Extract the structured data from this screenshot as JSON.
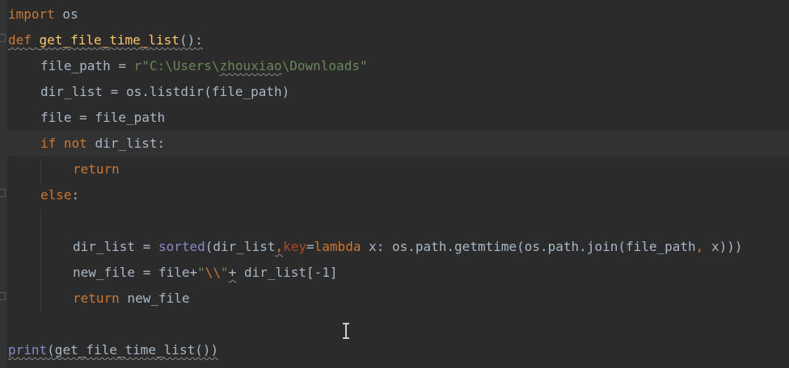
{
  "editor": {
    "lines": {
      "l1": {
        "kw_import": "import",
        "rest": " os"
      },
      "l2": {
        "kw_def": "def",
        "sp": " ",
        "fn_name": "get_file_time_list",
        "paren": "():"
      },
      "l3": {
        "lhs": "file_path = ",
        "str_prefix": "r\"C:\\Users\\",
        "str_user": "zhouxiao",
        "str_rest": "\\Downloads\""
      },
      "l4": {
        "text": "dir_list = os.listdir(file_path)"
      },
      "l5": {
        "text": "file = file_path"
      },
      "l6": {
        "kw_if": "if",
        "sp": " ",
        "kw_not": "not",
        "rest": " dir_list:"
      },
      "l7": {
        "kw_return": "return"
      },
      "l8": {
        "kw_else": "else",
        "colon": ":"
      },
      "l10": {
        "lhs": "dir_list = ",
        "builtin_sorted": "sorted",
        "part1": "(dir_list",
        "comma": ",",
        "param_key": "key",
        "eq": "=",
        "kw_lambda": "lambda",
        "part2": " x: os.path.getmtime(os.path.join(file_path",
        "comma2": ",",
        "part3": " x)))"
      },
      "l11": {
        "lhs": "new_file = file+",
        "str_open": "\"",
        "str_esc": "\\\\",
        "str_close": "\"",
        "plus": "+",
        "rest": " dir_list[-1]"
      },
      "l12": {
        "kw_return": "return",
        "rest": " new_file"
      },
      "l14": {
        "builtin_print": "print",
        "rest": "(get_file_time_list())"
      }
    }
  }
}
